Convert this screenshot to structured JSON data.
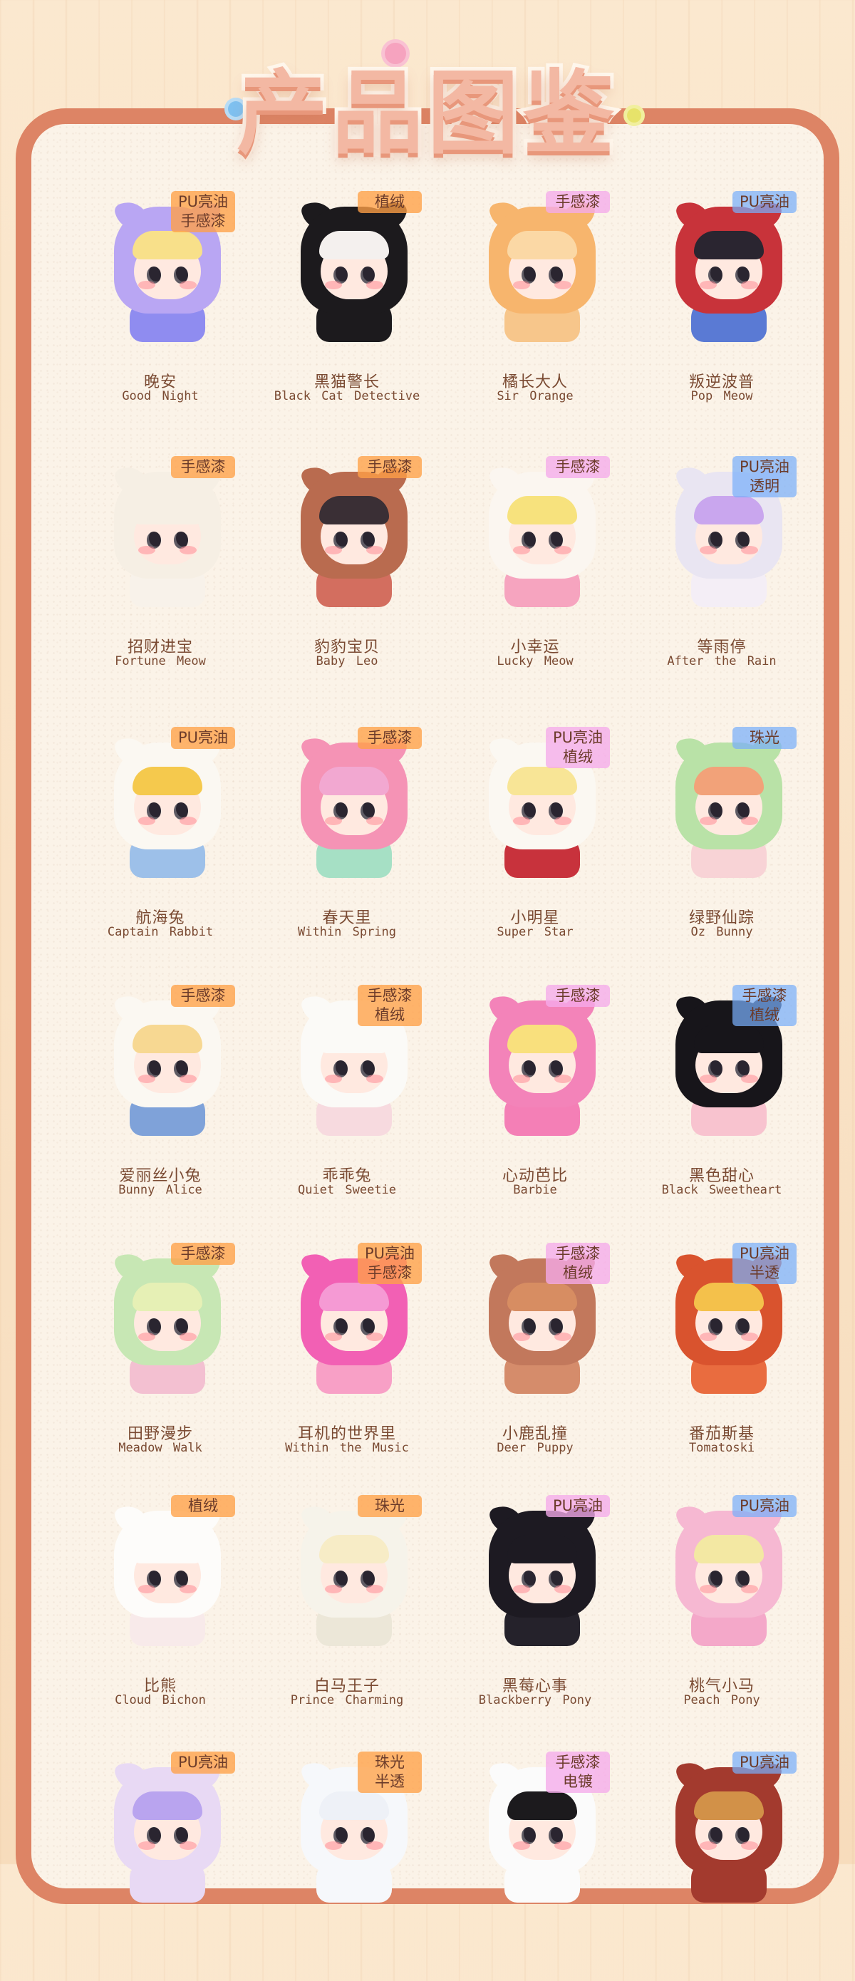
{
  "page": {
    "title": "产品图鉴",
    "colors": {
      "background": "#f9e3c6",
      "frame": "#dd8465",
      "panel": "#fbf3e8",
      "title_fill": "#f3b8a3",
      "text": "#7a4a32",
      "tag_orange": "#ffa046",
      "tag_pink": "#f5aaeb",
      "tag_blue": "#78aff9"
    }
  },
  "items": [
    {
      "cn": "晚安",
      "en": "Good  Night",
      "tag": "PU亮油\n手感漆",
      "tag_color": "orange",
      "hood": "#b9a6f3",
      "hair": "#f8e08a",
      "body": "#8f8cf0"
    },
    {
      "cn": "黑猫警长",
      "en": "Black  Cat  Detective",
      "tag": "植绒",
      "tag_color": "orange",
      "hood": "#1c1a1d",
      "hair": "#f4f0ee",
      "body": "#1c1a1d"
    },
    {
      "cn": "橘长大人",
      "en": "Sir  Orange",
      "tag": "手感漆",
      "tag_color": "pink",
      "hood": "#f7b56d",
      "hair": "#fbd8a5",
      "body": "#f7c68b"
    },
    {
      "cn": "叛逆波普",
      "en": "Pop  Meow",
      "tag": "PU亮油",
      "tag_color": "blue",
      "hood": "#c8333a",
      "hair": "#2a2530",
      "body": "#5a7ad4"
    },
    {
      "cn": "招财进宝",
      "en": "Fortune  Meow",
      "tag": "手感漆",
      "tag_color": "orange",
      "hood": "#f6efe4",
      "hair": "#f6efe4",
      "body": "#f8f2ea"
    },
    {
      "cn": "豹豹宝贝",
      "en": "Baby  Leo",
      "tag": "手感漆",
      "tag_color": "orange",
      "hood": "#b96b4f",
      "hair": "#3a2f35",
      "body": "#d36e5f"
    },
    {
      "cn": "小幸运",
      "en": "Lucky  Meow",
      "tag": "手感漆",
      "tag_color": "pink",
      "hood": "#fbf6f0",
      "hair": "#f7e27d",
      "body": "#f6a4bf"
    },
    {
      "cn": "等雨停",
      "en": "After  the  Rain",
      "tag": "PU亮油\n透明",
      "tag_color": "blue",
      "hood": "#e9e5f2",
      "hair": "#c9a6ee",
      "body": "#f4eef6"
    },
    {
      "cn": "航海兔",
      "en": "Captain  Rabbit",
      "tag": "PU亮油",
      "tag_color": "orange",
      "hood": "#fbf8f2",
      "hair": "#f5c94d",
      "body": "#9dc0e9"
    },
    {
      "cn": "春天里",
      "en": "Within  Spring",
      "tag": "手感漆",
      "tag_color": "orange",
      "hood": "#f593b5",
      "hair": "#f2a8d1",
      "body": "#a6e0c5"
    },
    {
      "cn": "小明星",
      "en": "Super  Star",
      "tag": "PU亮油\n植绒",
      "tag_color": "pink",
      "hood": "#fbf8f2",
      "hair": "#f8e596",
      "body": "#c8323c"
    },
    {
      "cn": "绿野仙踪",
      "en": "Oz  Bunny",
      "tag": "珠光",
      "tag_color": "blue",
      "hood": "#b9e2a7",
      "hair": "#f2a279",
      "body": "#f8d3d6"
    },
    {
      "cn": "爱丽丝小兔",
      "en": "Bunny  Alice",
      "tag": "手感漆",
      "tag_color": "orange",
      "hood": "#fbf8f2",
      "hair": "#f7d892",
      "body": "#7fa2d9"
    },
    {
      "cn": "乖乖兔",
      "en": "Quiet  Sweetie",
      "tag": "手感漆\n植绒",
      "tag_color": "orange",
      "hood": "#fbfaf7",
      "hair": "#fbfaf7",
      "body": "#f7dadf"
    },
    {
      "cn": "心动芭比",
      "en": "Barbie",
      "tag": "手感漆",
      "tag_color": "pink",
      "hood": "#f383b9",
      "hair": "#f9e07d",
      "body": "#f47fb6"
    },
    {
      "cn": "黑色甜心",
      "en": "Black  Sweetheart",
      "tag": "手感漆\n植绒",
      "tag_color": "blue",
      "hood": "#17151a",
      "hair": "#17151a",
      "body": "#f8c3cf"
    },
    {
      "cn": "田野漫步",
      "en": "Meadow  Walk",
      "tag": "手感漆",
      "tag_color": "orange",
      "hood": "#c7e7b4",
      "hair": "#e6f0b5",
      "body": "#f3c0d1"
    },
    {
      "cn": "耳机的世界里",
      "en": "Within  the  Music",
      "tag": "PU亮油\n手感漆",
      "tag_color": "orange",
      "hood": "#f260b4",
      "hair": "#f59ad4",
      "body": "#f8a0c6"
    },
    {
      "cn": "小鹿乱撞",
      "en": "Deer  Puppy",
      "tag": "手感漆\n植绒",
      "tag_color": "pink",
      "hood": "#c2785c",
      "hair": "#d78d62",
      "body": "#d58c6b"
    },
    {
      "cn": "番茄斯基",
      "en": "Tomatoski",
      "tag": "PU亮油\n半透",
      "tag_color": "blue",
      "hood": "#d9532e",
      "hair": "#f4c14b",
      "body": "#e96c3f"
    },
    {
      "cn": "比熊",
      "en": "Cloud  Bichon",
      "tag": "植绒",
      "tag_color": "orange",
      "hood": "#fdfcfa",
      "hair": "#fdfcfa",
      "body": "#f8eaea"
    },
    {
      "cn": "白马王子",
      "en": "Prince  Charming",
      "tag": "珠光",
      "tag_color": "orange",
      "hood": "#f6f3ea",
      "hair": "#f7ecc6",
      "body": "#ece7d8"
    },
    {
      "cn": "黑莓心事",
      "en": "Blackberry  Pony",
      "tag": "PU亮油",
      "tag_color": "pink",
      "hood": "#1d1a22",
      "hair": "#1d1a22",
      "body": "#25222b"
    },
    {
      "cn": "桃气小马",
      "en": "Peach  Pony",
      "tag": "PU亮油",
      "tag_color": "blue",
      "hood": "#f6b8d2",
      "hair": "#f3e8a3",
      "body": "#f4a8c9"
    },
    {
      "cn": "",
      "en": "",
      "tag": "PU亮油",
      "tag_color": "orange",
      "hood": "#e8d9f4",
      "hair": "#b9a4ef",
      "body": "#e8d9f4"
    },
    {
      "cn": "",
      "en": "",
      "tag": "珠光\n半透",
      "tag_color": "orange",
      "hood": "#f6f8fb",
      "hair": "#eef1f7",
      "body": "#f6f8fb"
    },
    {
      "cn": "",
      "en": "",
      "tag": "手感漆\n电镀",
      "tag_color": "pink",
      "hood": "#fbfbfb",
      "hair": "#1c1a1d",
      "body": "#fbfbfb"
    },
    {
      "cn": "",
      "en": "",
      "tag": "PU亮油",
      "tag_color": "blue",
      "hood": "#a33a2e",
      "hair": "#d29148",
      "body": "#a33a2e"
    }
  ]
}
